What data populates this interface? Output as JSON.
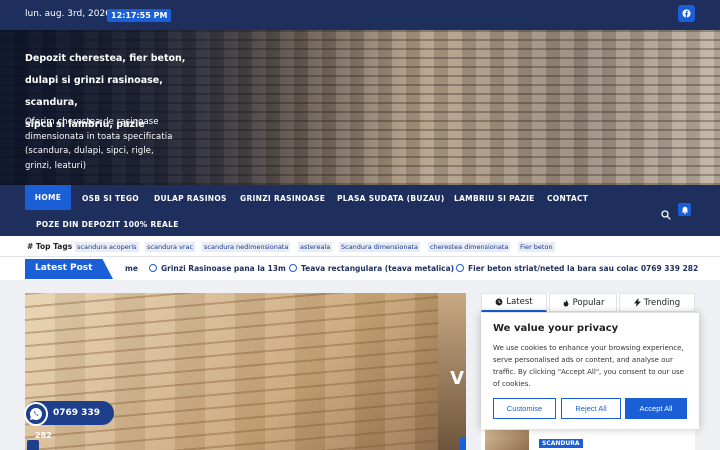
{
  "topbar": {
    "date": "lun. aug. 3rd, 2026",
    "time": "12:17:55 PM",
    "social_icon": "facebook-icon"
  },
  "hero": {
    "title_lines": [
      "Depozit cherestea, fier beton,",
      "dulapi si grinzi rasinoase, scandura,",
      "sipca si lambriu, pazie"
    ],
    "desc_lines": [
      "Oferim cherestea de rasinoase",
      "dimensionata in toata specificatia",
      "(scandura, dulapi, sipci, rigle,",
      "grinzi, leaturi)"
    ]
  },
  "nav": {
    "items": [
      "HOME",
      "OSB SI TEGO",
      "DULAP RASINOS",
      "GRINZI RASINOASE",
      "PLASA SUDATA (BUZAU)",
      "LAMBRIU SI PAZIE",
      "CONTACT"
    ],
    "second_row": "POZE DIN DEPOZIT 100% REALE"
  },
  "tags": {
    "label": "# Top Tags",
    "items": [
      "scandura acoperis",
      "scandura vrac",
      "scandura nedimensionata",
      "astereala",
      "Scandura dimensionata",
      "cherestea dimensionata",
      "Fier beton"
    ]
  },
  "ticker": {
    "label": "Latest Post",
    "items": [
      "me",
      "Grinzi Rasinoase pana la 13m",
      "Teava rectangulara (teava metalica)",
      "Fier beton striat/neted la bara sau colac 0769 339 282"
    ]
  },
  "panel": {
    "tabs": [
      "Latest",
      "Popular",
      "Trending"
    ],
    "tab_icons": [
      "clock-icon",
      "fire-icon",
      "bolt-icon"
    ],
    "badge": "SCANDURA"
  },
  "main_image": {
    "overlay_text": "V"
  },
  "whatsapp": {
    "number": "0769 339",
    "number_cont": "282"
  },
  "cookie": {
    "title": "We value your privacy",
    "text_lines": [
      "We use cookies to enhance your browsing experience,",
      "serve personalised ads or content, and analyse our",
      "traffic. By clicking \"Accept All\", you consent to our use",
      "of cookies."
    ],
    "buttons": [
      "Customise",
      "Reject All",
      "Accept All"
    ]
  },
  "colors": {
    "navy": "#1e2f5e",
    "accent": "#1a5fd6"
  }
}
